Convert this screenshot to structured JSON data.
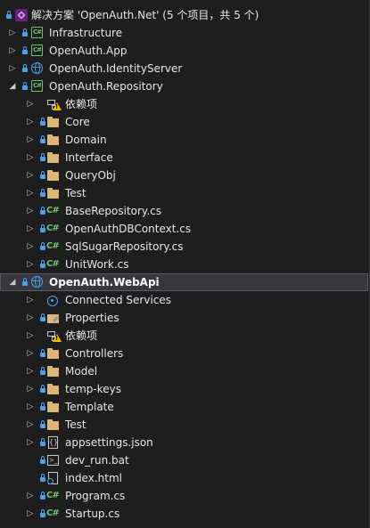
{
  "solution": {
    "title": "解决方案 'OpenAuth.Net' (5 个项目，共 5 个)"
  },
  "rows": [
    {
      "label": "解决方案 'OpenAuth.Net' (5 个项目，共 5 个)",
      "icon": "solution-icon",
      "indent": 0,
      "arrow": "none",
      "lock": true
    },
    {
      "label": "Infrastructure",
      "icon": "csharp-project-icon",
      "indent": 1,
      "arrow": "collapsed",
      "lock": true
    },
    {
      "label": "OpenAuth.App",
      "icon": "csharp-project-icon",
      "indent": 1,
      "arrow": "collapsed",
      "lock": true
    },
    {
      "label": "OpenAuth.IdentityServer",
      "icon": "web-project-icon",
      "indent": 1,
      "arrow": "collapsed",
      "lock": true
    },
    {
      "label": "OpenAuth.Repository",
      "icon": "csharp-project-icon",
      "indent": 1,
      "arrow": "expanded",
      "lock": true
    },
    {
      "label": "依赖项",
      "icon": "dependencies-warning-icon",
      "indent": 2,
      "arrow": "collapsed",
      "lock": false
    },
    {
      "label": "Core",
      "icon": "folder-icon",
      "indent": 2,
      "arrow": "collapsed",
      "lock": true
    },
    {
      "label": "Domain",
      "icon": "folder-icon",
      "indent": 2,
      "arrow": "collapsed",
      "lock": true
    },
    {
      "label": "Interface",
      "icon": "folder-icon",
      "indent": 2,
      "arrow": "collapsed",
      "lock": true
    },
    {
      "label": "QueryObj",
      "icon": "folder-icon",
      "indent": 2,
      "arrow": "collapsed",
      "lock": true
    },
    {
      "label": "Test",
      "icon": "folder-icon",
      "indent": 2,
      "arrow": "collapsed",
      "lock": true
    },
    {
      "label": "BaseRepository.cs",
      "icon": "csharp-file-icon",
      "indent": 2,
      "arrow": "collapsed",
      "lock": true
    },
    {
      "label": "OpenAuthDBContext.cs",
      "icon": "csharp-file-icon",
      "indent": 2,
      "arrow": "collapsed",
      "lock": true
    },
    {
      "label": "SqlSugarRepository.cs",
      "icon": "csharp-file-icon",
      "indent": 2,
      "arrow": "collapsed",
      "lock": true
    },
    {
      "label": "UnitWork.cs",
      "icon": "csharp-file-icon",
      "indent": 2,
      "arrow": "collapsed",
      "lock": true
    },
    {
      "label": "OpenAuth.WebApi",
      "icon": "web-project-icon",
      "indent": 1,
      "arrow": "expanded",
      "lock": true,
      "selected": true
    },
    {
      "label": "Connected Services",
      "icon": "connected-services-icon",
      "indent": 2,
      "arrow": "collapsed",
      "lock": false
    },
    {
      "label": "Properties",
      "icon": "properties-icon",
      "indent": 2,
      "arrow": "collapsed",
      "lock": true
    },
    {
      "label": "依赖项",
      "icon": "dependencies-warning-icon",
      "indent": 2,
      "arrow": "collapsed",
      "lock": false
    },
    {
      "label": "Controllers",
      "icon": "folder-icon",
      "indent": 2,
      "arrow": "collapsed",
      "lock": true
    },
    {
      "label": "Model",
      "icon": "folder-icon",
      "indent": 2,
      "arrow": "collapsed",
      "lock": true
    },
    {
      "label": "temp-keys",
      "icon": "folder-icon",
      "indent": 2,
      "arrow": "collapsed",
      "lock": true
    },
    {
      "label": "Template",
      "icon": "folder-icon",
      "indent": 2,
      "arrow": "collapsed",
      "lock": true
    },
    {
      "label": "Test",
      "icon": "folder-icon",
      "indent": 2,
      "arrow": "collapsed",
      "lock": true
    },
    {
      "label": "appsettings.json",
      "icon": "json-file-icon",
      "indent": 2,
      "arrow": "collapsed",
      "lock": true
    },
    {
      "label": "dev_run.bat",
      "icon": "batch-file-icon",
      "indent": 2,
      "arrow": "none",
      "lock": true
    },
    {
      "label": "index.html",
      "icon": "html-file-icon",
      "indent": 2,
      "arrow": "none",
      "lock": true
    },
    {
      "label": "Program.cs",
      "icon": "csharp-file-icon",
      "indent": 2,
      "arrow": "collapsed",
      "lock": true
    },
    {
      "label": "Startup.cs",
      "icon": "csharp-file-icon",
      "indent": 2,
      "arrow": "collapsed",
      "lock": true
    }
  ],
  "colors": {
    "background": "#1e1e1e",
    "selected_row": "#37373d",
    "folder": "#dcb67a",
    "csharp": "#6fc26b",
    "lock": "#4e9ee8",
    "warning": "#f0c000"
  }
}
